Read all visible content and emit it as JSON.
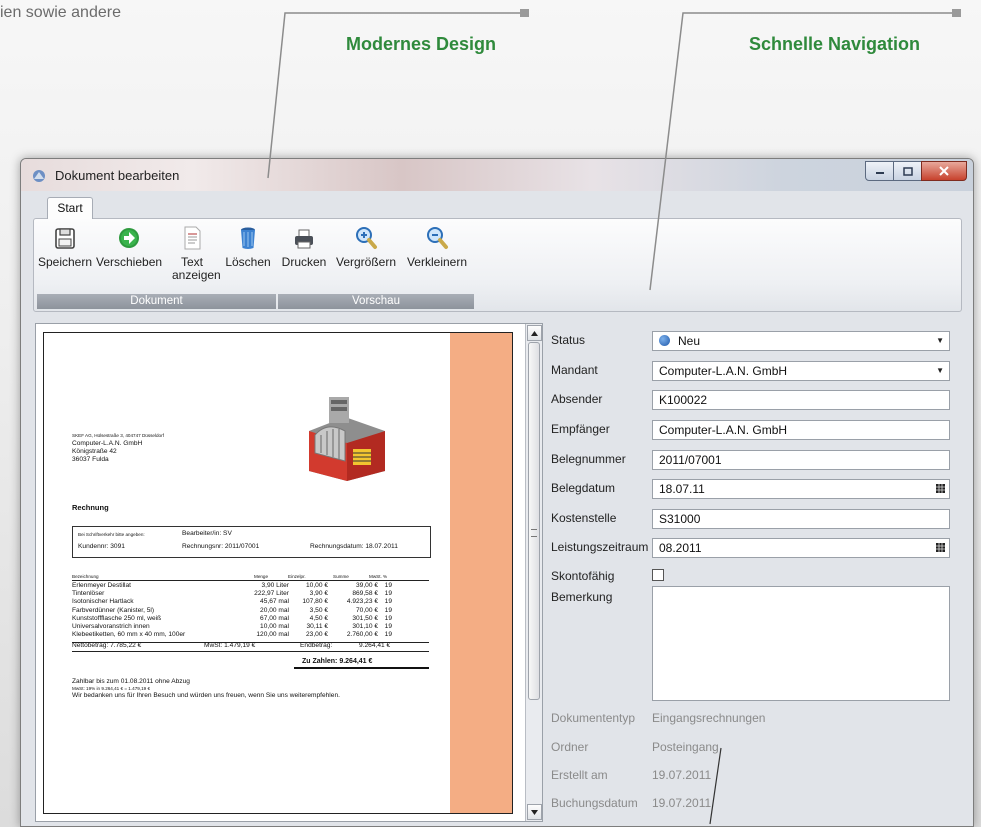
{
  "page": {
    "intro_text": "ien sowie andere",
    "callout_1": "Modernes Design",
    "callout_2": "Schnelle Navigation"
  },
  "window": {
    "title": "Dokument bearbeiten",
    "tab": "Start"
  },
  "ribbon": {
    "groups": [
      {
        "caption": "Dokument",
        "buttons": [
          {
            "label": "Speichern"
          },
          {
            "label": "Verschieben"
          },
          {
            "label": "Text anzeigen"
          },
          {
            "label": "Löschen"
          }
        ]
      },
      {
        "caption": "Vorschau",
        "buttons": [
          {
            "label": "Drucken"
          },
          {
            "label": "Vergrößern"
          },
          {
            "label": "Verkleinern"
          }
        ]
      }
    ]
  },
  "invoice": {
    "sender_line": "SKEF AG, Hülsestraße 3, 404747 Düsseldorf",
    "recipient": [
      "Computer-L.A.N. GmbH",
      "Königstraße 42",
      "36037 Fulda"
    ],
    "heading": "Rechnung",
    "ref_hint": "Bei Schriftverkehr bitte angeben:",
    "clerk": "Bearbeiter/in: SV",
    "customer_no": "Kundennr: 3091",
    "invoice_no": "Rechnungsnr: 2011/07001",
    "invoice_date": "Rechnungsdatum: 18.07.2011",
    "columns": [
      "Bezeichnung",
      "Menge",
      "Einzelpr.",
      "Summe",
      "MwSt. %"
    ],
    "rows": [
      [
        "Erlenmeyer Destillat",
        "3,90 Liter",
        "10,00 €",
        "39,00 €",
        "19"
      ],
      [
        "Tintenlöser",
        "222,97 Liter",
        "3,90 €",
        "869,58 €",
        "19"
      ],
      [
        "Isotonischer Hartlack",
        "45,67 mal",
        "107,80 €",
        "4.923,23 €",
        "19"
      ],
      [
        "Farbverdünner (Kanister, 5l)",
        "20,00 mal",
        "3,50 €",
        "70,00 €",
        "19"
      ],
      [
        "Kunststoffflasche 250 ml, weiß",
        "67,00 mal",
        "4,50 €",
        "301,50 €",
        "19"
      ],
      [
        "Universalvoranstrich innen",
        "10,00 mal",
        "30,11 €",
        "301,10 €",
        "19"
      ],
      [
        "Klebeetiketten, 60 mm x 40 mm, 100er",
        "120,00 mal",
        "23,00 €",
        "2.760,00 €",
        "19"
      ]
    ],
    "net": "Nettobetrag: 7.785,22 €",
    "vat": "MwSt: 1.479,19 €",
    "gross": "Endbetrag:",
    "gross_value": "9.264,41 €",
    "total": "Zu Zahlen:  9.264,41 €",
    "payment": "Zahlbar bis zum 01.08.2011 ohne Abzug",
    "vat_detail": "MwSt:   19% in       9.264,41 €     =    1.479,19 €",
    "thanks": "Wir bedanken uns für Ihren Besuch und würden uns freuen, wenn Sie uns weiterempfehlen."
  },
  "form": {
    "status": {
      "label": "Status",
      "value": "Neu"
    },
    "mandant": {
      "label": "Mandant",
      "value": "Computer-L.A.N. GmbH"
    },
    "absender": {
      "label": "Absender",
      "value": "K100022"
    },
    "empfaenger": {
      "label": "Empfänger",
      "value": "Computer-L.A.N. GmbH"
    },
    "belegnummer": {
      "label": "Belegnummer",
      "value": "2011/07001"
    },
    "belegdatum": {
      "label": "Belegdatum",
      "value": "18.07.11"
    },
    "kostenstelle": {
      "label": "Kostenstelle",
      "value": "S31000"
    },
    "leistungszeitraum": {
      "label": "Leistungszeitraum",
      "value": "08.2011"
    },
    "skontofaehig": {
      "label": "Skontofähig",
      "checked": false
    },
    "bemerkung": {
      "label": "Bemerkung",
      "value": ""
    },
    "dokumententyp": {
      "label": "Dokumententyp",
      "value": "Eingangsrechnungen"
    },
    "ordner": {
      "label": "Ordner",
      "value": "Posteingang"
    },
    "erstellt": {
      "label": "Erstellt am",
      "value": "19.07.2011"
    },
    "buchungsdatum": {
      "label": "Buchungsdatum",
      "value": "19.07.2011"
    }
  },
  "colors": {
    "accent_green": "#2f8a3c",
    "page_band": "#f4ad84"
  }
}
